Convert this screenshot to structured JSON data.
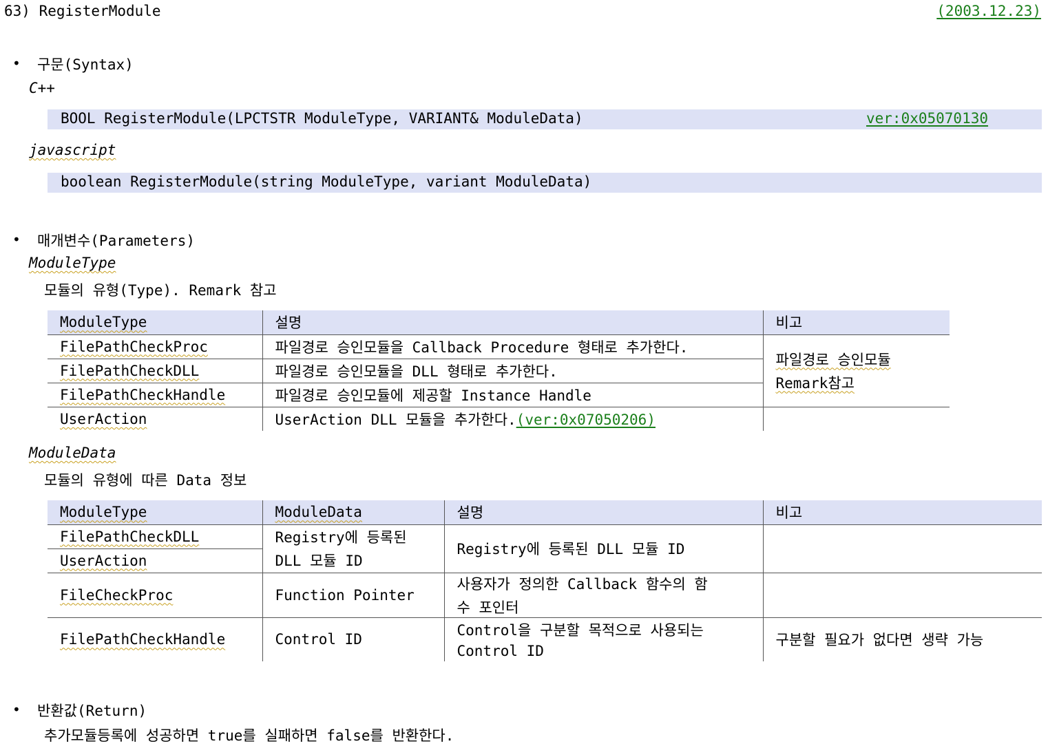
{
  "header": {
    "number_title": "63) RegisterModule",
    "date": "(2003.12.23)"
  },
  "syntax": {
    "heading": "구문(Syntax)",
    "cpp_label": "C++",
    "cpp_code": "BOOL RegisterModule(LPCTSTR ModuleType, VARIANT& ModuleData)",
    "cpp_version": "ver:0x05070130",
    "js_label": "javascript",
    "js_code": "boolean RegisterModule(string ModuleType, variant ModuleData)"
  },
  "parameters": {
    "heading": "매개변수(Parameters)",
    "module_type": {
      "name": "ModuleType",
      "desc": "모듈의 유형(Type). Remark 참고",
      "table": {
        "headers": [
          "ModuleType",
          "설명",
          "비고"
        ],
        "rows": [
          {
            "type": "FilePathCheckProc",
            "desc": "파일경로 승인모듈을 Callback Procedure 형태로 추가한다."
          },
          {
            "type": "FilePathCheckDLL",
            "desc": "파일경로 승인모듈을 DLL 형태로 추가한다."
          },
          {
            "type": "FilePathCheckHandle",
            "desc": "파일경로 승인모듈에 제공할 Instance Handle"
          },
          {
            "type": "UserAction",
            "desc": "UserAction DLL 모듈을 추가한다.",
            "version": "(ver:0x07050206)"
          }
        ],
        "remark_line1": "파일경로 승인모듈",
        "remark_line2": "Remark참고"
      }
    },
    "module_data": {
      "name": "ModuleData",
      "desc": "모듈의 유형에 따른 Data 정보",
      "table": {
        "headers": [
          "ModuleType",
          "ModuleData",
          "설명",
          "비고"
        ],
        "row1": {
          "type_a": "FilePathCheckDLL",
          "type_b": "UserAction",
          "data_line1": "Registry에 등록된",
          "data_line2": "DLL 모듈 ID",
          "desc": "Registry에 등록된 DLL 모듈 ID",
          "remark": ""
        },
        "row2": {
          "type": "FileCheckProc",
          "data": "Function Pointer",
          "desc_line1": "사용자가 정의한 Callback 함수의 함",
          "desc_line2": "수 포인터",
          "remark": ""
        },
        "row3": {
          "type": "FilePathCheckHandle",
          "data": "Control ID",
          "desc_line1": "Control을 구분할 목적으로 사용되는",
          "desc_line2": "Control ID",
          "remark": "구분할 필요가 없다면 생략 가능"
        }
      }
    }
  },
  "return_value": {
    "heading": "반환값(Return)",
    "desc": "추가모듈등록에 성공하면 true를 실패하면 false를 반환한다."
  }
}
